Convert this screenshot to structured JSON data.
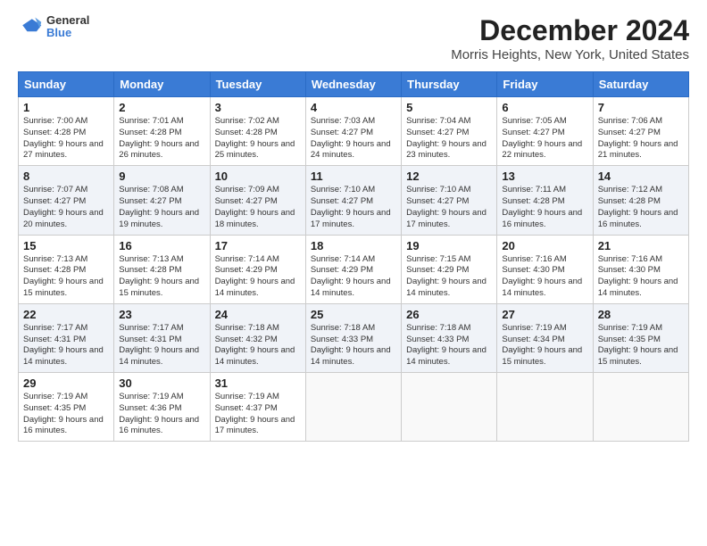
{
  "header": {
    "title": "December 2024",
    "subtitle": "Morris Heights, New York, United States",
    "logo_line1": "General",
    "logo_line2": "Blue"
  },
  "weekdays": [
    "Sunday",
    "Monday",
    "Tuesday",
    "Wednesday",
    "Thursday",
    "Friday",
    "Saturday"
  ],
  "weeks": [
    [
      {
        "day": "1",
        "info": "Sunrise: 7:00 AM\nSunset: 4:28 PM\nDaylight: 9 hours and 27 minutes."
      },
      {
        "day": "2",
        "info": "Sunrise: 7:01 AM\nSunset: 4:28 PM\nDaylight: 9 hours and 26 minutes."
      },
      {
        "day": "3",
        "info": "Sunrise: 7:02 AM\nSunset: 4:28 PM\nDaylight: 9 hours and 25 minutes."
      },
      {
        "day": "4",
        "info": "Sunrise: 7:03 AM\nSunset: 4:27 PM\nDaylight: 9 hours and 24 minutes."
      },
      {
        "day": "5",
        "info": "Sunrise: 7:04 AM\nSunset: 4:27 PM\nDaylight: 9 hours and 23 minutes."
      },
      {
        "day": "6",
        "info": "Sunrise: 7:05 AM\nSunset: 4:27 PM\nDaylight: 9 hours and 22 minutes."
      },
      {
        "day": "7",
        "info": "Sunrise: 7:06 AM\nSunset: 4:27 PM\nDaylight: 9 hours and 21 minutes."
      }
    ],
    [
      {
        "day": "8",
        "info": "Sunrise: 7:07 AM\nSunset: 4:27 PM\nDaylight: 9 hours and 20 minutes."
      },
      {
        "day": "9",
        "info": "Sunrise: 7:08 AM\nSunset: 4:27 PM\nDaylight: 9 hours and 19 minutes."
      },
      {
        "day": "10",
        "info": "Sunrise: 7:09 AM\nSunset: 4:27 PM\nDaylight: 9 hours and 18 minutes."
      },
      {
        "day": "11",
        "info": "Sunrise: 7:10 AM\nSunset: 4:27 PM\nDaylight: 9 hours and 17 minutes."
      },
      {
        "day": "12",
        "info": "Sunrise: 7:10 AM\nSunset: 4:27 PM\nDaylight: 9 hours and 17 minutes."
      },
      {
        "day": "13",
        "info": "Sunrise: 7:11 AM\nSunset: 4:28 PM\nDaylight: 9 hours and 16 minutes."
      },
      {
        "day": "14",
        "info": "Sunrise: 7:12 AM\nSunset: 4:28 PM\nDaylight: 9 hours and 16 minutes."
      }
    ],
    [
      {
        "day": "15",
        "info": "Sunrise: 7:13 AM\nSunset: 4:28 PM\nDaylight: 9 hours and 15 minutes."
      },
      {
        "day": "16",
        "info": "Sunrise: 7:13 AM\nSunset: 4:28 PM\nDaylight: 9 hours and 15 minutes."
      },
      {
        "day": "17",
        "info": "Sunrise: 7:14 AM\nSunset: 4:29 PM\nDaylight: 9 hours and 14 minutes."
      },
      {
        "day": "18",
        "info": "Sunrise: 7:14 AM\nSunset: 4:29 PM\nDaylight: 9 hours and 14 minutes."
      },
      {
        "day": "19",
        "info": "Sunrise: 7:15 AM\nSunset: 4:29 PM\nDaylight: 9 hours and 14 minutes."
      },
      {
        "day": "20",
        "info": "Sunrise: 7:16 AM\nSunset: 4:30 PM\nDaylight: 9 hours and 14 minutes."
      },
      {
        "day": "21",
        "info": "Sunrise: 7:16 AM\nSunset: 4:30 PM\nDaylight: 9 hours and 14 minutes."
      }
    ],
    [
      {
        "day": "22",
        "info": "Sunrise: 7:17 AM\nSunset: 4:31 PM\nDaylight: 9 hours and 14 minutes."
      },
      {
        "day": "23",
        "info": "Sunrise: 7:17 AM\nSunset: 4:31 PM\nDaylight: 9 hours and 14 minutes."
      },
      {
        "day": "24",
        "info": "Sunrise: 7:18 AM\nSunset: 4:32 PM\nDaylight: 9 hours and 14 minutes."
      },
      {
        "day": "25",
        "info": "Sunrise: 7:18 AM\nSunset: 4:33 PM\nDaylight: 9 hours and 14 minutes."
      },
      {
        "day": "26",
        "info": "Sunrise: 7:18 AM\nSunset: 4:33 PM\nDaylight: 9 hours and 14 minutes."
      },
      {
        "day": "27",
        "info": "Sunrise: 7:19 AM\nSunset: 4:34 PM\nDaylight: 9 hours and 15 minutes."
      },
      {
        "day": "28",
        "info": "Sunrise: 7:19 AM\nSunset: 4:35 PM\nDaylight: 9 hours and 15 minutes."
      }
    ],
    [
      {
        "day": "29",
        "info": "Sunrise: 7:19 AM\nSunset: 4:35 PM\nDaylight: 9 hours and 16 minutes."
      },
      {
        "day": "30",
        "info": "Sunrise: 7:19 AM\nSunset: 4:36 PM\nDaylight: 9 hours and 16 minutes."
      },
      {
        "day": "31",
        "info": "Sunrise: 7:19 AM\nSunset: 4:37 PM\nDaylight: 9 hours and 17 minutes."
      },
      {
        "day": "",
        "info": ""
      },
      {
        "day": "",
        "info": ""
      },
      {
        "day": "",
        "info": ""
      },
      {
        "day": "",
        "info": ""
      }
    ]
  ]
}
